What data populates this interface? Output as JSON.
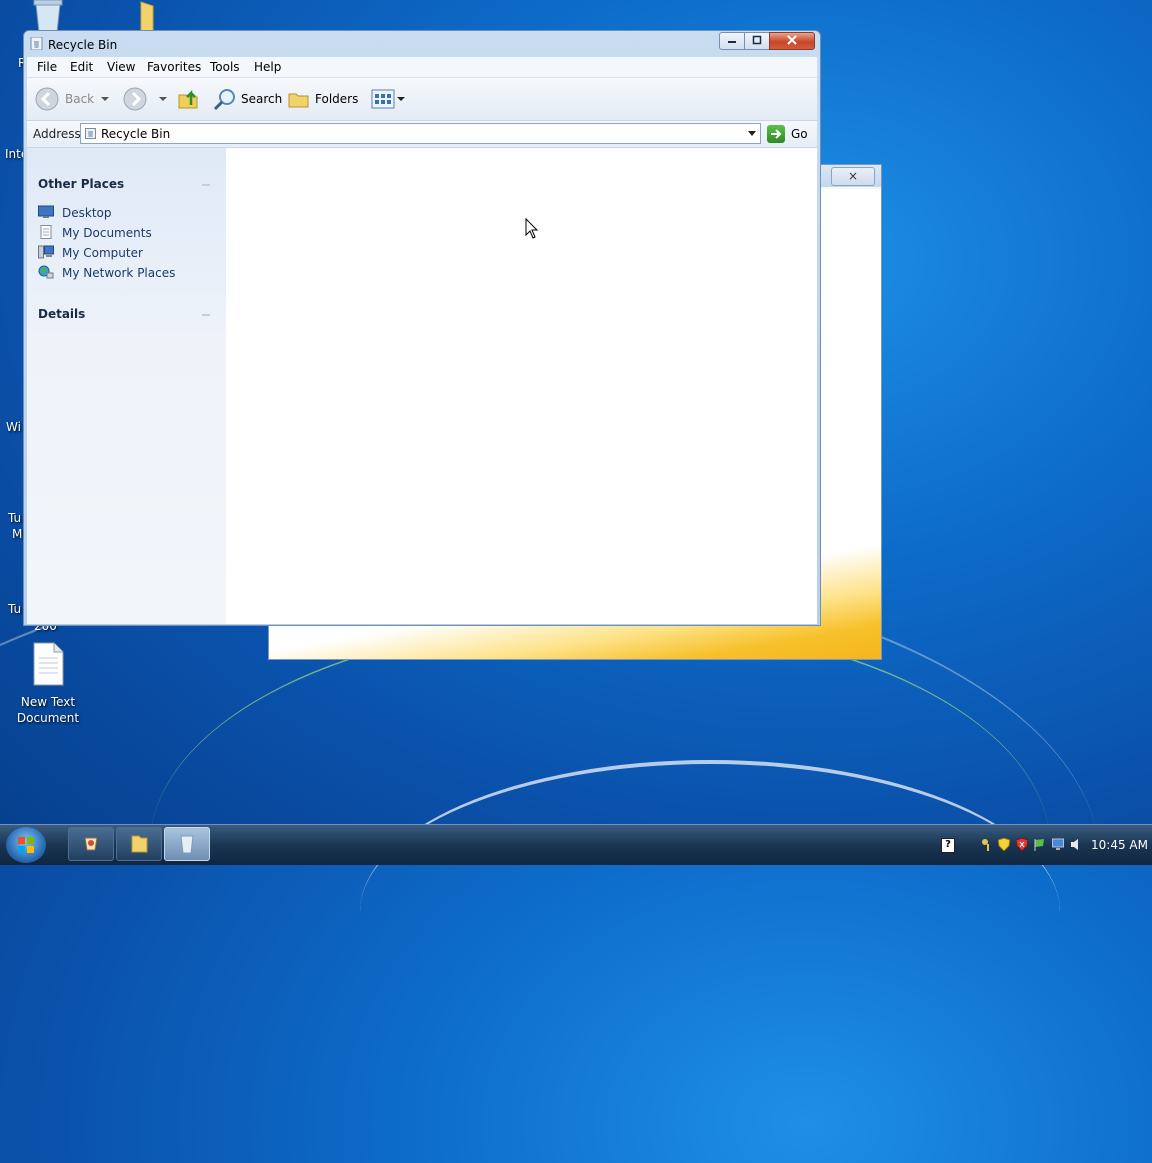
{
  "desktop": {
    "icons": [
      {
        "label": "New Text Document"
      }
    ],
    "partial_labels": [
      "R",
      "Inte",
      "Wi",
      "Tu",
      "M",
      "Tu",
      "200"
    ]
  },
  "background_window": {
    "close_glyph": "×"
  },
  "window": {
    "title": "Recycle Bin",
    "menu": [
      "File",
      "Edit",
      "View",
      "Favorites",
      "Tools",
      "Help"
    ],
    "toolbar": {
      "back": "Back",
      "search": "Search",
      "folders": "Folders"
    },
    "address": {
      "label": "Address",
      "value": "Recycle Bin",
      "go": "Go"
    },
    "other_places": {
      "title": "Other Places",
      "items": [
        "Desktop",
        "My Documents",
        "My Computer",
        "My Network Places"
      ]
    },
    "details": {
      "title": "Details"
    }
  },
  "taskbar": {
    "clock": "10:45 AM",
    "tray_help_glyph": "?"
  }
}
